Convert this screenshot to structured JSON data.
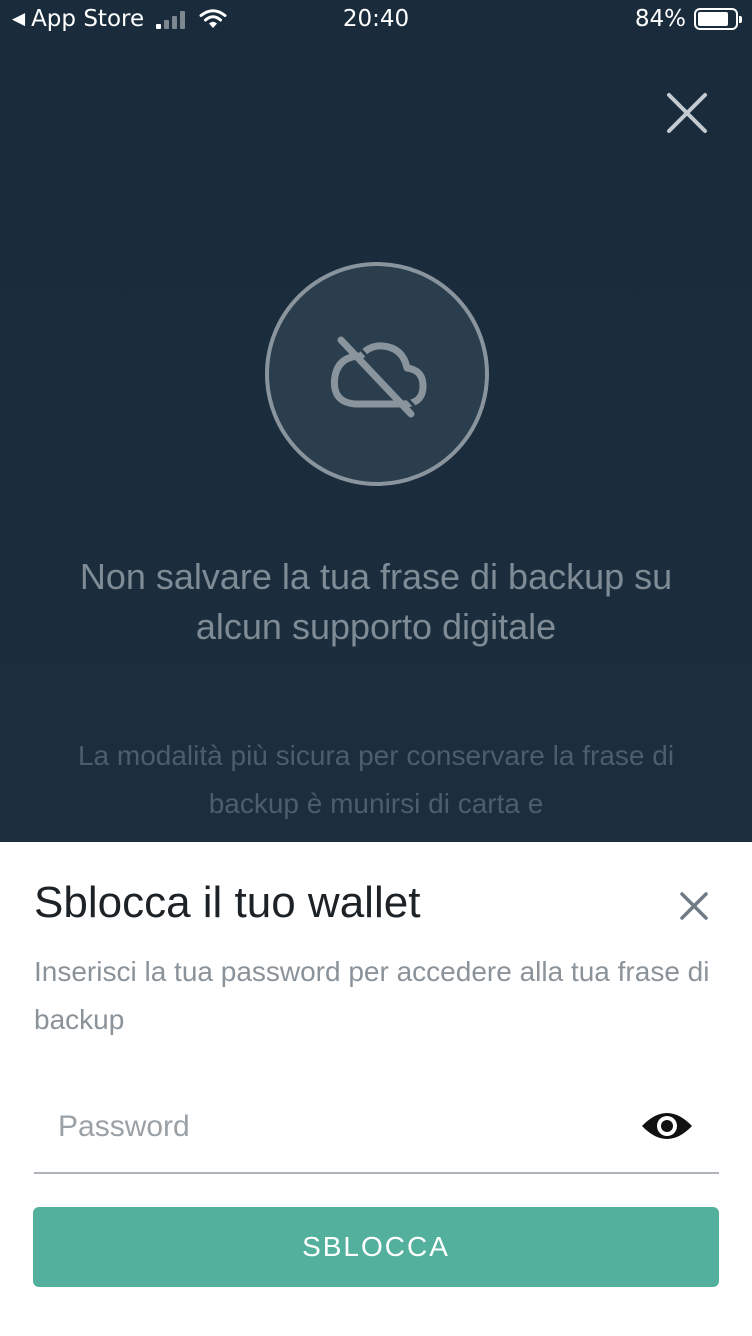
{
  "status_bar": {
    "back_label": "App Store",
    "time": "20:40",
    "battery_percent": "84%",
    "battery_level": 0.84
  },
  "background_screen": {
    "headline": "Non salvare la tua frase di backup su alcun supporto digitale",
    "description": "La modalità più sicura per conservare la frase di backup è munirsi di carta e",
    "icon": "cloud-off-icon"
  },
  "sheet": {
    "title": "Sblocca il tuo wallet",
    "subtitle": "Inserisci la tua password per accedere alla tua frase di backup",
    "password_placeholder": "Password",
    "password_value": "",
    "unlock_label": "SBLOCCA",
    "accent_color": "#52b09c"
  }
}
